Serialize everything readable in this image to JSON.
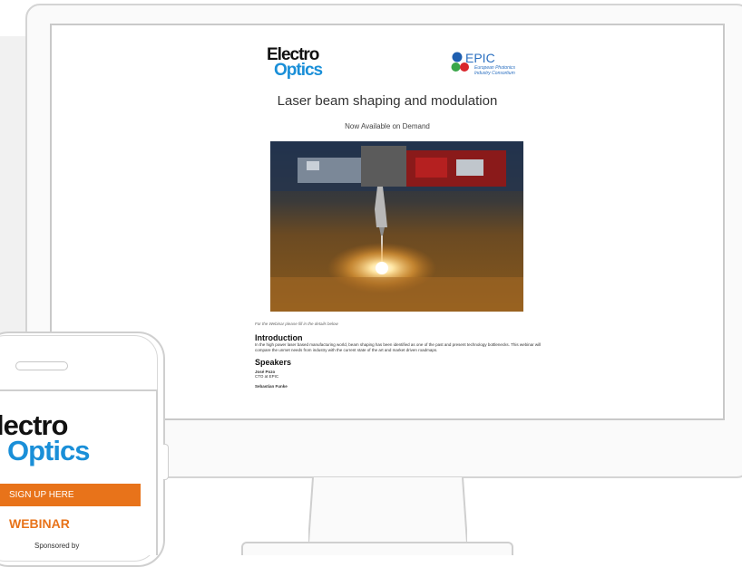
{
  "desktop": {
    "logo_left": {
      "line1": "Electro",
      "line2": "Optics"
    },
    "logo_right": {
      "name": "EPIC",
      "tagline_1": "European Photonics",
      "tagline_2": "Industry Consortium"
    },
    "title": "Laser beam shaping and modulation",
    "subtitle": "Now Available on Demand",
    "hero_image": "laser-cutting-photo",
    "form_note": "For the Webinar please fill in the details below",
    "intro_heading": "Introduction",
    "intro_text": "In the high power laser based manufacturing world, beam shaping has been identified as one of the past and present technology bottlenecks. This webinar will compare the unmet needs from industry with the current state of the art and market driven roadmaps.",
    "speakers_heading": "Speakers",
    "speakers": [
      {
        "name": "José Pozo",
        "role": "CTO at EPIC"
      },
      {
        "name": "Sebastian Funke",
        "role": ""
      }
    ]
  },
  "mobile": {
    "logo": {
      "line1": "lectro",
      "line2": "Optics"
    },
    "signup_label": "SIGN UP HERE",
    "webinar_label": "WEBINAR",
    "sponsored_label": "Sponsored by"
  },
  "colors": {
    "accent_orange": "#e8731a",
    "brand_blue": "#1a8fd8"
  }
}
